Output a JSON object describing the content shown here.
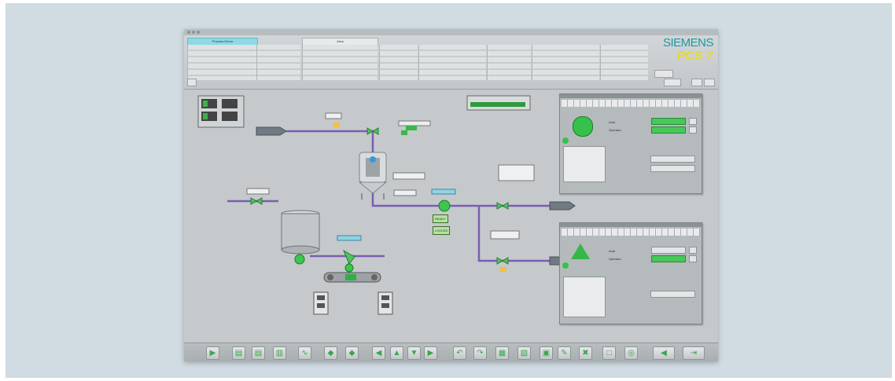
{
  "header": {
    "plant_label": "Process Demo",
    "area_label": "Area",
    "logo_siemens": "SIEMENS",
    "logo_pcs": "PCS 7"
  },
  "process": {
    "status_ready": "READY",
    "status_locked": "LOCKED"
  },
  "faceplate_top": {
    "mode_label": "Auto",
    "sub_label": "Operator"
  },
  "faceplate_bottom": {
    "mode_label": "Auto",
    "sub_label": "Operator"
  },
  "toolbar": {
    "icons": [
      "play-icon",
      "folder-icon",
      "folder-icon",
      "document-icon",
      "trend-icon",
      "alarm-icon",
      "alarm-icon",
      "arrow-left-icon",
      "arrow-up-icon",
      "arrow-down-icon",
      "arrow-right-icon",
      "back-icon",
      "forward-icon",
      "overview-icon",
      "report-icon",
      "print-icon",
      "edit-icon",
      "delete-icon",
      "monitor-icon",
      "search-icon",
      "speaker-icon",
      "exit-icon"
    ]
  }
}
